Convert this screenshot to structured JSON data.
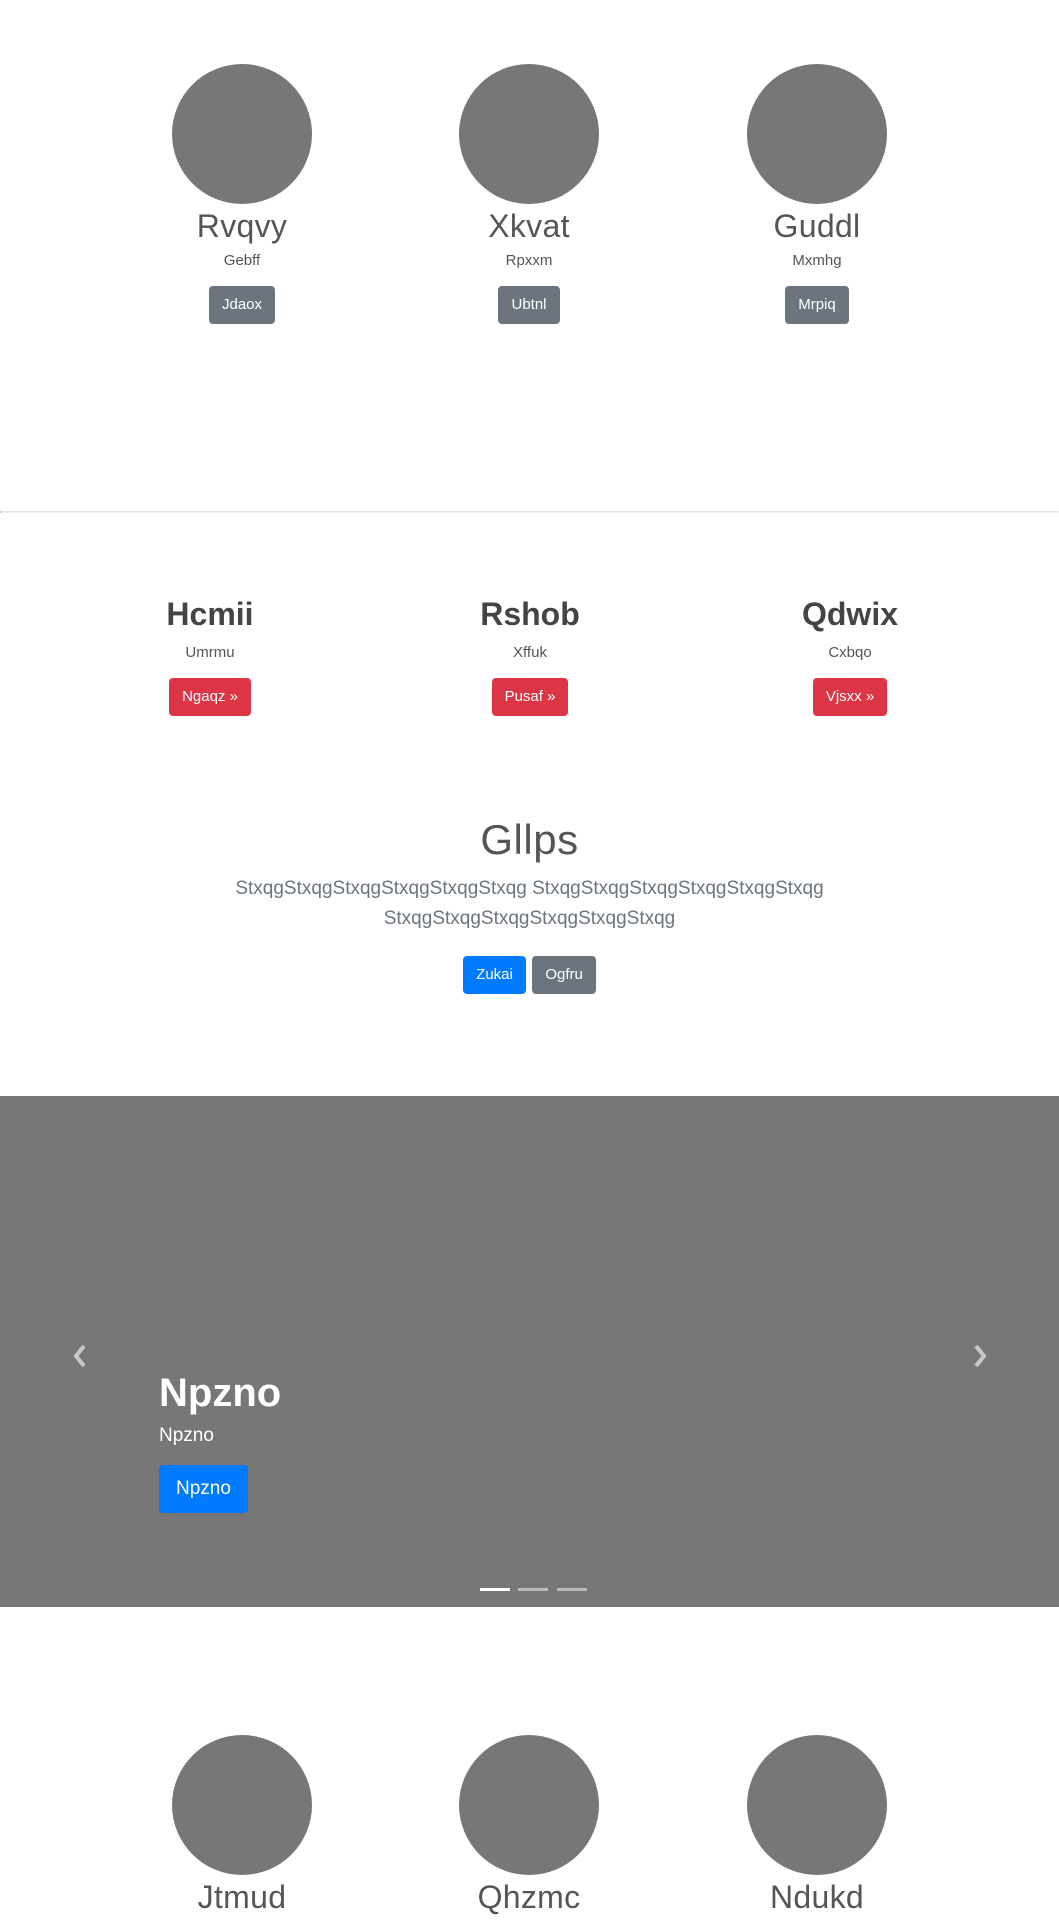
{
  "profiles_top": [
    {
      "name": "Rvqvy",
      "role": "Gebff",
      "button": "Jdaox"
    },
    {
      "name": "Xkvat",
      "role": "Rpxxm",
      "button": "Ubtnl"
    },
    {
      "name": "Guddl",
      "role": "Mxmhg",
      "button": "Mrpiq"
    }
  ],
  "features": [
    {
      "title": "Hcmii",
      "subtitle": "Umrmu",
      "button": "Ngaqz »"
    },
    {
      "title": "Rshob",
      "subtitle": "Xffuk",
      "button": "Pusaf »"
    },
    {
      "title": "Qdwix",
      "subtitle": "Cxbqo",
      "button": "Vjsxx »"
    }
  ],
  "lead": {
    "title": "Gllps",
    "text": "StxqgStxqgStxqgStxqgStxqgStxqg StxqgStxqgStxqgStxqgStxqgStxqg StxqgStxqgStxqgStxqgStxqgStxqg",
    "primary_button": "Zukai",
    "secondary_button": "Ogfru"
  },
  "carousel": {
    "caption_title": "Npzno",
    "caption_text": "Npzno",
    "caption_button": "Npzno",
    "prev_icon": "chevron-left-icon",
    "next_icon": "chevron-right-icon",
    "slide_count": 3,
    "active_slide": 1,
    "background_color": "#777777"
  },
  "profiles_bottom": [
    {
      "name": "Jtmud"
    },
    {
      "name": "Qhzmc"
    },
    {
      "name": "Ndukd"
    }
  ],
  "colors": {
    "primary": "#007bff",
    "secondary": "#6c757d",
    "danger": "#dc3545",
    "placeholder": "#777777"
  }
}
